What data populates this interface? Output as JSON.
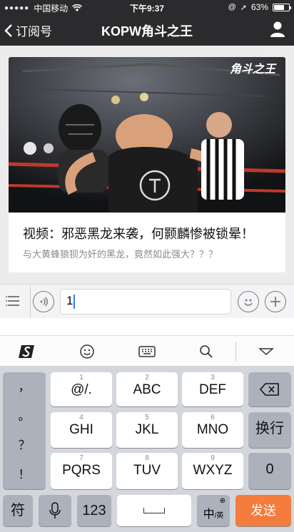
{
  "status": {
    "carrier": "中国移动",
    "time": "下午9:37",
    "battery": "63%",
    "battery_level": 0.63
  },
  "nav": {
    "back_label": "订阅号",
    "title": "KOPW角斗之王",
    "profile_icon": "person-icon"
  },
  "article": {
    "watermark": "角斗之王",
    "headline": "视频：邪恶黑龙来袭，何颢麟惨被锁晕！",
    "subtitle": "与大黄蜂狼狈为奸的黑龙，竟然如此强大？？？"
  },
  "composer": {
    "input_value": "1"
  },
  "keyboard": {
    "punctuation": [
      "，",
      "。",
      "？",
      "！"
    ],
    "rows": [
      [
        {
          "num": "1",
          "label": "@/."
        },
        {
          "num": "2",
          "label": "ABC"
        },
        {
          "num": "3",
          "label": "DEF"
        }
      ],
      [
        {
          "num": "4",
          "label": "GHI"
        },
        {
          "num": "5",
          "label": "JKL"
        },
        {
          "num": "6",
          "label": "MNO"
        }
      ],
      [
        {
          "num": "7",
          "label": "PQRS"
        },
        {
          "num": "8",
          "label": "TUV"
        },
        {
          "num": "9",
          "label": "WXYZ"
        }
      ]
    ],
    "newline_label": "换行",
    "zero_label": "0",
    "symbols_label": "符",
    "numbers_label": "123",
    "lang_label": "中",
    "lang_sub": "/英",
    "send_label": "发送"
  },
  "colors": {
    "topbar": "#2b2b2d",
    "send_key": "#f47c3c",
    "caret": "#2d80e6"
  }
}
